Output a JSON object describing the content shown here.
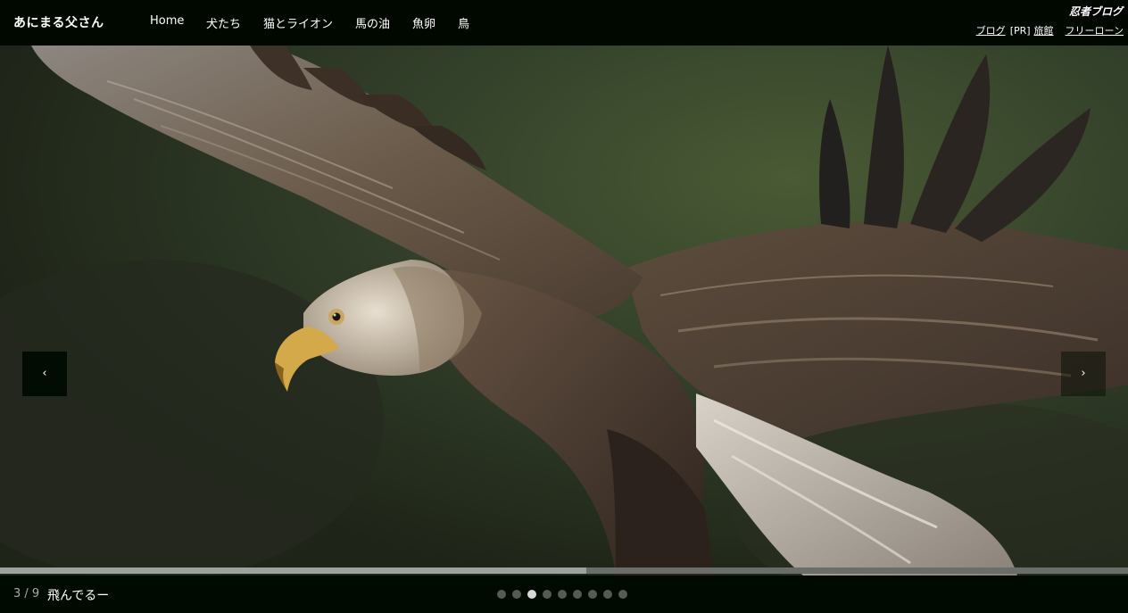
{
  "header": {
    "site_title": "あにまる父さん",
    "nav": [
      {
        "label": "Home"
      },
      {
        "label": "犬たち"
      },
      {
        "label": "猫とライオン"
      },
      {
        "label": "馬の油"
      },
      {
        "label": "魚卵"
      },
      {
        "label": "鳥"
      }
    ],
    "brand_logo_text": "忍者ブログ",
    "ad_links": {
      "blog": "ブログ",
      "pr": "[PR]",
      "ryokan": "旅館",
      "loan": "フリーローン"
    }
  },
  "slideshow": {
    "prev_label": "‹",
    "next_label": "›",
    "image_icon": "eagle-photo",
    "current_index": 3,
    "total": 9,
    "counter_text": "3 / 9",
    "caption": "飛んでるー",
    "progress_fraction": 0.52,
    "dots": [
      1,
      2,
      3,
      4,
      5,
      6,
      7,
      8,
      9
    ],
    "colors": {
      "accent": "#000a00",
      "dot_active": "#d8d8d8",
      "dot_inactive": "#555a55"
    }
  }
}
